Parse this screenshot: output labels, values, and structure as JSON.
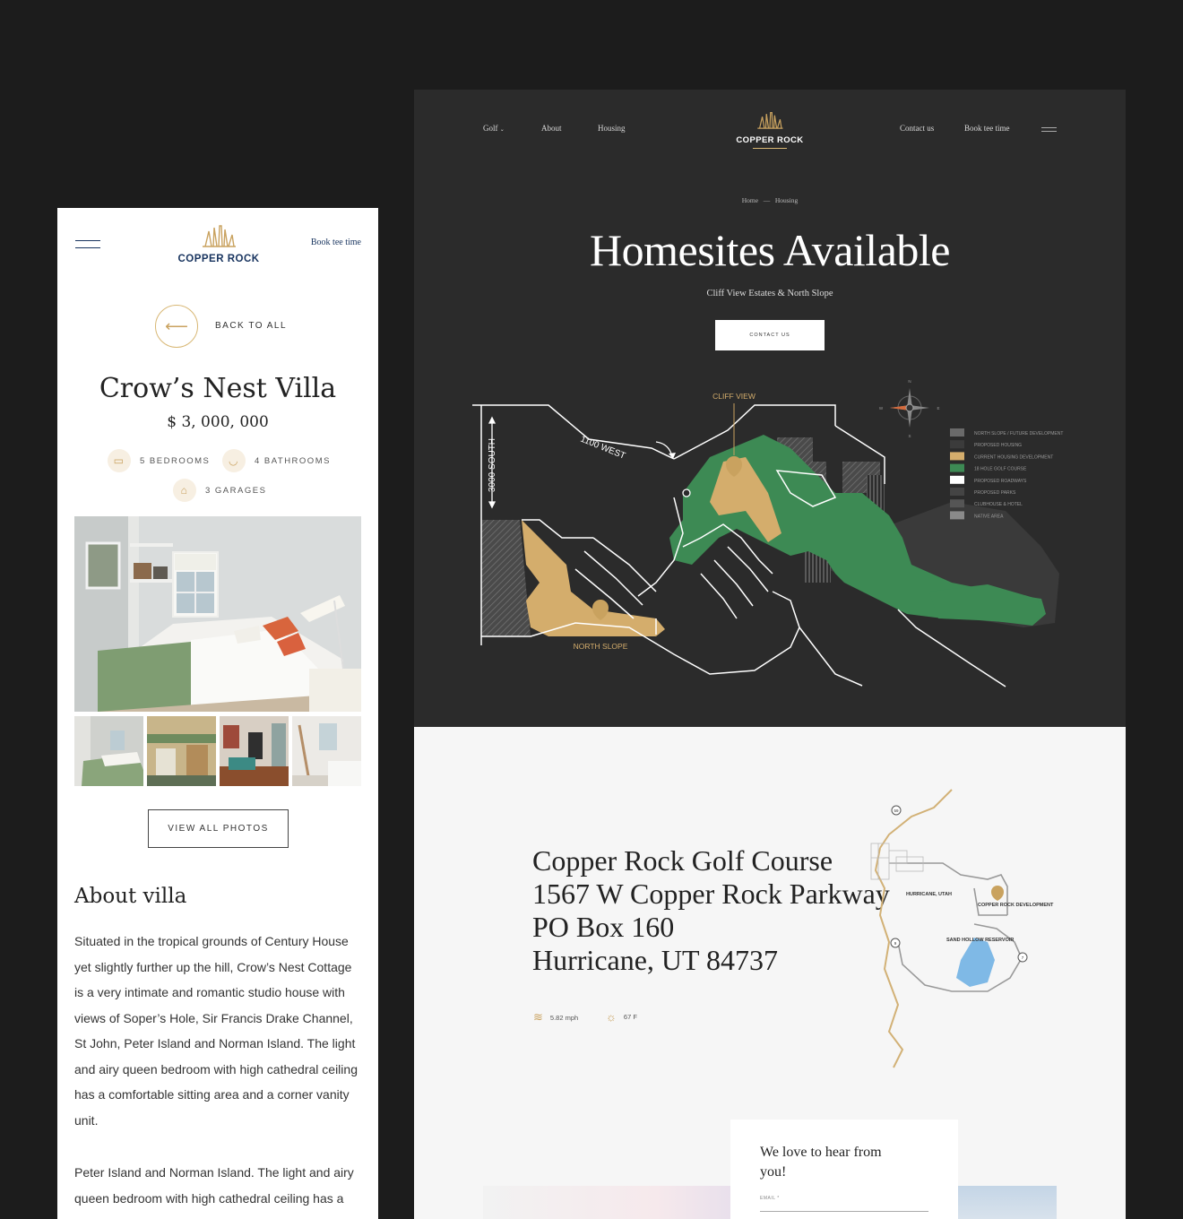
{
  "mobile": {
    "brand": "COPPER ROCK",
    "book_label": "Book tee time",
    "back_label": "BACK TO ALL",
    "villa_name": "Crow’s Nest Villa",
    "price": "$ 3, 000, 000",
    "features": {
      "bedrooms": "5 BEDROOMS",
      "bathrooms": "4 BATHROOMS",
      "garages": "3 GARAGES"
    },
    "view_photos_label": "VIEW ALL PHOTOS",
    "about_heading": "About villa",
    "about_paragraph_1": "Situated in the tropical grounds of Century House yet slightly further up the hill, Crow’s Nest Cottage is a very intimate and romantic studio house with views of Soper’s Hole, Sir Francis Drake Channel, St John, Peter Island and Norman Island. The light and airy queen bedroom with high cathedral ceiling has a comfortable sitting area and a corner vanity unit.",
    "about_paragraph_2": "Peter Island and Norman Island. The light and airy queen bedroom with high cathedral ceiling has a comfortable sitting area and a corner vanity unit."
  },
  "desktop": {
    "nav": {
      "golf": "Golf",
      "about": "About",
      "housing": "Housing",
      "contact": "Contact us",
      "book": "Book tee time"
    },
    "brand": "COPPER ROCK",
    "breadcrumb": {
      "home": "Home",
      "separator": "—",
      "current": "Housing"
    },
    "hero_title": "Homesites Available",
    "hero_subtitle": "Cliff View Estates & North Slope",
    "hero_button": "CONTACT US",
    "site_map": {
      "label_cliff_view": "CLIFF VIEW",
      "label_north_slope": "NORTH SLOPE",
      "label_1100_west": "1100 WEST",
      "label_3000_south": "3000 SOUTH",
      "compass": {
        "n": "N",
        "s": "S",
        "e": "E",
        "w": "W"
      },
      "legend": [
        {
          "label": "NORTH SLOPE / FUTURE DEVELOPMENT",
          "color": "#6a6a6a"
        },
        {
          "label": "PROPOSED HOUSING",
          "color": "#3b3b3b"
        },
        {
          "label": "CURRENT HOUSING DEVELOPMENT",
          "color": "#d4ad6c"
        },
        {
          "label": "18 HOLE GOLF COURSE",
          "color": "#3d8a54"
        },
        {
          "label": "PROPOSED ROADWAYS",
          "color": "#ffffff"
        },
        {
          "label": "PROPOSED PARKS",
          "color": "#444444"
        },
        {
          "label": "CLUBHOUSE & HOTEL",
          "color": "#555555"
        },
        {
          "label": "NATIVE AREA",
          "color": "#8a8a8a"
        }
      ]
    },
    "address": {
      "line1": "Copper Rock Golf Course",
      "line2": "1567 W Copper Rock Parkway",
      "line3": "PO Box 160",
      "line4": "Hurricane, UT 84737"
    },
    "weather": {
      "wind": "5.82 mph",
      "temp": "67 F"
    },
    "area_map": {
      "hurricane": "HURRICANE, UTAH",
      "copper_rock": "COPPER ROCK DEVELOPMENT",
      "sand_hollow": "SAND HOLLOW RESERVOIR",
      "route_59": "59",
      "route_9": "9",
      "route_7": "7"
    },
    "contact_card": {
      "title": "We love to hear from you!",
      "email_label": "EMAIL *"
    }
  }
}
